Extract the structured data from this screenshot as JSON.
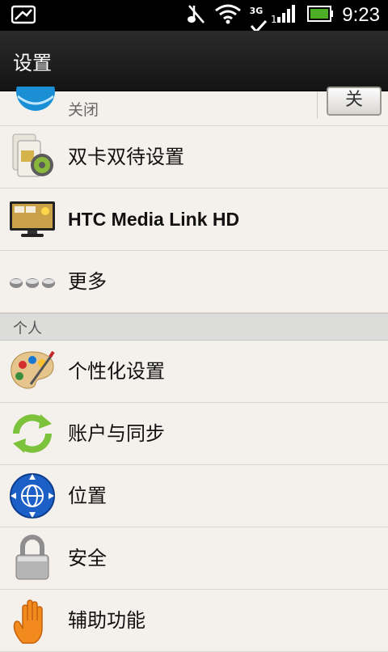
{
  "status_bar": {
    "time": "9:23",
    "network": "3G",
    "icons": [
      "screenshot-icon",
      "music-muted-icon",
      "wifi-icon",
      "data-3g-icon",
      "signal-icon",
      "battery-icon"
    ]
  },
  "title": "设置",
  "partial_item": {
    "subtitle": "关闭",
    "toggle_label": "关"
  },
  "items_top": [
    {
      "label": "双卡双待设置",
      "icon": "dual-sim-gear-icon"
    },
    {
      "label": "HTC Media Link HD",
      "icon": "tv-icon"
    },
    {
      "label": "更多",
      "icon": "more-dots-icon"
    }
  ],
  "section_personal": "个人",
  "items_personal": [
    {
      "label": "个性化设置",
      "icon": "palette-icon"
    },
    {
      "label": "账户与同步",
      "icon": "sync-icon"
    },
    {
      "label": "位置",
      "icon": "location-globe-icon"
    },
    {
      "label": "安全",
      "icon": "lock-icon"
    },
    {
      "label": "辅助功能",
      "icon": "hand-icon"
    }
  ]
}
